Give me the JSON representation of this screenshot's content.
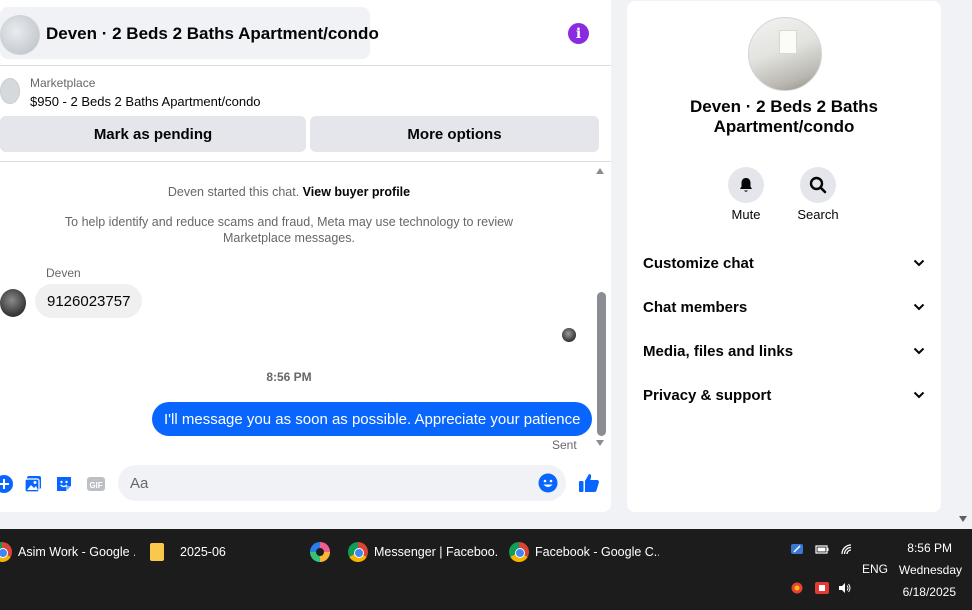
{
  "chat": {
    "header_title": "Deven · 2 Beds 2 Baths Apartment/condo",
    "marketplace_label": "Marketplace",
    "listing_text": "$950 - 2 Beds 2 Baths Apartment/condo",
    "mark_pending_label": "Mark as pending",
    "more_options_label": "More options",
    "notice_started_prefix": "Deven started this chat.",
    "notice_view_profile": "View buyer profile",
    "notice_scam": "To help identify and reduce scams and fraud, Meta may use technology to review Marketplace messages.",
    "incoming_sender": "Deven",
    "incoming_message": "9126023757",
    "timestamp": "8:56 PM",
    "outgoing_message": "I'll message you as soon as possible. Appreciate your patience",
    "sent_status": "Sent",
    "input_placeholder": "Aa",
    "input_value": ""
  },
  "info_panel": {
    "title": "Deven · 2 Beds 2 Baths Apartment/condo",
    "mute_label": "Mute",
    "search_label": "Search",
    "sections": [
      "Customize chat",
      "Chat members",
      "Media, files and links",
      "Privacy & support"
    ]
  },
  "taskbar": {
    "items": [
      "Asim Work - Google ...",
      "2025-06",
      "Messenger | Faceboo...",
      "Facebook - Google C..."
    ],
    "lang": "ENG",
    "time": "8:56 PM",
    "day": "Wednesday",
    "date": "6/18/2025"
  },
  "colors": {
    "accent": "#0866ff",
    "info_button": "#8a2be2",
    "taskbar_bg": "#1c1c1c"
  }
}
